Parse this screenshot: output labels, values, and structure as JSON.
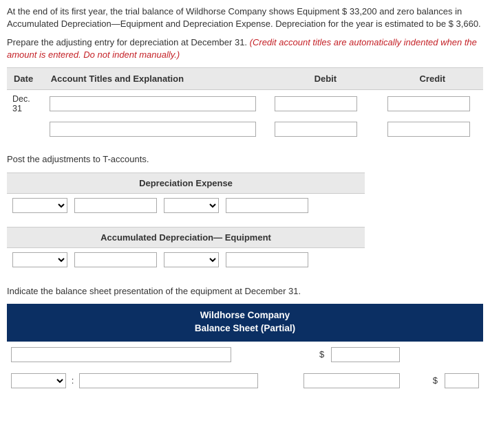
{
  "intro": {
    "para1": "At the end of its first year, the trial balance of Wildhorse Company shows Equipment $ 33,200 and zero balances in Accumulated Depreciation—Equipment and Depreciation Expense. Depreciation for the year is estimated to be $ 3,660.",
    "para2_plain": "Prepare the adjusting entry for depreciation at December 31. ",
    "para2_red": "(Credit account titles are automatically indented when the amount is entered. Do not indent manually.)"
  },
  "journal": {
    "headers": {
      "date": "Date",
      "account": "Account Titles and Explanation",
      "debit": "Debit",
      "credit": "Credit"
    },
    "date_value": "Dec. 31"
  },
  "taccounts_intro": "Post the adjustments to T-accounts.",
  "taccount1_title": "Depreciation Expense",
  "taccount2_title": "Accumulated Depreciation— Equipment",
  "balance_intro": "Indicate the balance sheet presentation of the equipment at December 31.",
  "bs_header_line1": "Wildhorse Company",
  "bs_header_line2": "Balance Sheet (Partial)",
  "dollar": "$",
  "colon": ":"
}
